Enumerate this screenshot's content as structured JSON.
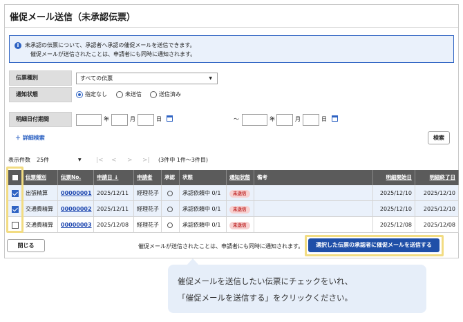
{
  "page_title": "催促メール送信（未承認伝票）",
  "info": {
    "icon": "info-icon",
    "line1": "未承認の伝票について、承認者へ承認の催促メールを送信できます。",
    "line2": "催促メールが送信されたことは、申請者にも同時に通知されます。"
  },
  "filters": {
    "slip_type_label": "伝票種別",
    "slip_type_value": "すべての伝票",
    "notify_label": "通知状態",
    "notify_options": [
      "指定なし",
      "未送信",
      "送信済み"
    ],
    "notify_selected": "指定なし",
    "period_label": "明細日付期間",
    "year": "年",
    "month": "月",
    "day": "日",
    "tilde": "～"
  },
  "detail_search": "＋ 詳細検索",
  "search_button": "検索",
  "pager": {
    "display_count_label": "表示件数",
    "display_count_value": "25件",
    "summary": "(3件中 1件〜3件目)"
  },
  "table": {
    "headers": [
      "伝票種別",
      "伝票No.",
      "申請日 ↓",
      "申請者",
      "承認",
      "状態",
      "通知状態",
      "備考",
      "明細開始日",
      "明細終了日"
    ],
    "rows": [
      {
        "checked": true,
        "type": "出張精算",
        "no": "00000001",
        "date": "2025/12/11",
        "applicant": "経理花子",
        "status": "承認依頼中 0/1",
        "notify": "未送信",
        "remark": "",
        "start": "2025/12/10",
        "end": "2025/12/10"
      },
      {
        "checked": true,
        "type": "交通費精算",
        "no": "00000002",
        "date": "2025/12/11",
        "applicant": "経理花子",
        "status": "承認依頼中 0/1",
        "notify": "未送信",
        "remark": "",
        "start": "2025/12/10",
        "end": "2025/12/10"
      },
      {
        "checked": false,
        "type": "交通費精算",
        "no": "00000003",
        "date": "2025/12/08",
        "applicant": "経理花子",
        "status": "承認依頼中 0/1",
        "notify": "未送信",
        "remark": "",
        "start": "2025/12/08",
        "end": "2025/12/08"
      }
    ]
  },
  "footer": {
    "close_button": "閉じる",
    "note": "催促メールが送信されたことは、申請者にも同時に通知されます。",
    "send_button": "選択した伝票の承認者に催促メールを送信する"
  },
  "callout": {
    "line1": "催促メールを送信したい伝票にチェックをいれ、",
    "line2": "「催促メールを送信する」をクリックください。"
  },
  "colors": {
    "accent": "#2e63c3",
    "send_button": "#1f4fa8",
    "header_bg": "#5b5b5b",
    "badge_bg": "#f7d1d1",
    "badge_text": "#c23030",
    "highlight": "#f2dc82"
  }
}
